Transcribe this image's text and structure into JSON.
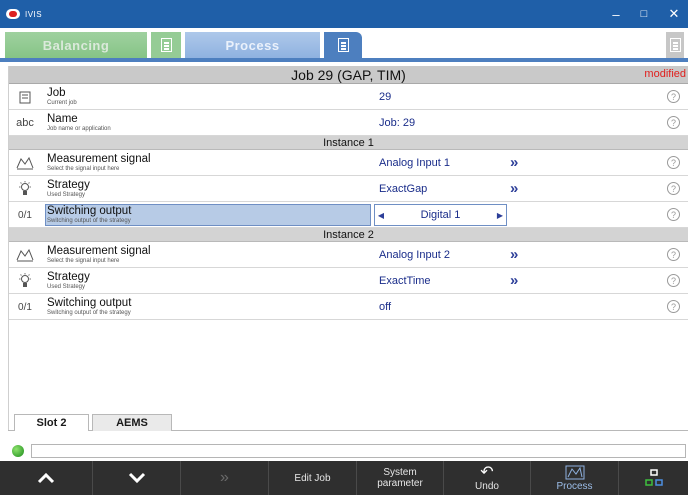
{
  "window": {
    "title": "IVIS",
    "minimize": "–",
    "maximize": "□",
    "close": "✕"
  },
  "tabs": {
    "balancing": "Balancing",
    "process": "Process"
  },
  "job": {
    "title": "Job 29 (GAP, TIM)",
    "status": "modified"
  },
  "rows": {
    "job": {
      "icon": "job-icon",
      "label": "Job",
      "sub": "Current job",
      "value": "29"
    },
    "name": {
      "icon": "abc-icon",
      "icon_text": "abc",
      "label": "Name",
      "sub": "Job name or application",
      "value": "Job: 29"
    }
  },
  "instance1": {
    "header": "Instance 1",
    "measurement": {
      "label": "Measurement signal",
      "sub": "Select the signal input here",
      "value": "Analog Input 1",
      "chev": "»"
    },
    "strategy": {
      "label": "Strategy",
      "sub": "Used Strategy",
      "value": "ExactGap",
      "chev": "»"
    },
    "switching": {
      "icon_text": "0/1",
      "label": "Switching output",
      "sub": "Switching output of the strategy",
      "value": "Digital 1",
      "left_arrow": "◀",
      "right_arrow": "▶"
    }
  },
  "instance2": {
    "header": "Instance 2",
    "measurement": {
      "label": "Measurement signal",
      "sub": "Select the signal input here",
      "value": "Analog Input 2",
      "chev": "»"
    },
    "strategy": {
      "label": "Strategy",
      "sub": "Used Strategy",
      "value": "ExactTime",
      "chev": "»"
    },
    "switching": {
      "icon_text": "0/1",
      "label": "Switching output",
      "sub": "Switching output of the strategy",
      "value": "off"
    }
  },
  "help": "?",
  "slot_tabs": [
    "Slot 2",
    "AEMS"
  ],
  "toolbar": {
    "up": "︿",
    "down": "﹀",
    "next": "»",
    "edit_job": "Edit Job",
    "system_parameter_1": "System",
    "system_parameter_2": "parameter",
    "undo": "Undo",
    "undo_glyph": "↶",
    "process": "Process"
  },
  "colors": {
    "titlebar": "#1f5fa8",
    "balancing_tab": "#86c486",
    "process_tab": "#4d7fbf",
    "modified": "#e0201e",
    "selection": "#b7cbe6"
  }
}
